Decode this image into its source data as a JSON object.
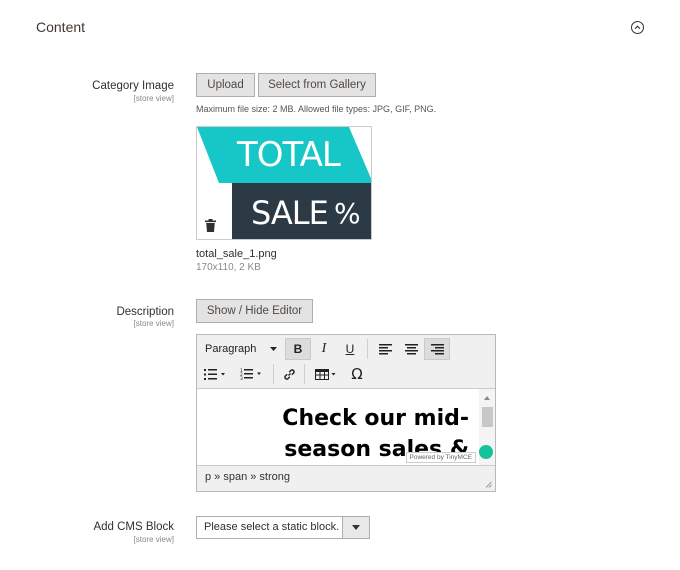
{
  "section": {
    "title": "Content"
  },
  "category_image": {
    "label": "Category Image",
    "scope": "[store view]",
    "upload_label": "Upload",
    "gallery_label": "Select from Gallery",
    "note": "Maximum file size: 2 MB. Allowed file types: JPG, GIF, PNG.",
    "preview": {
      "line1": "TOTAL",
      "line2": "SALE",
      "symbol": "%"
    },
    "file_name": "total_sale_1.png",
    "file_meta": "170x110, 2 KB"
  },
  "description": {
    "label": "Description",
    "scope": "[store view]",
    "toggle_label": "Show / Hide Editor",
    "editor": {
      "format_select": "Paragraph",
      "bold": "B",
      "italic": "I",
      "underline": "U",
      "content_text": "Check our mid-season sales &",
      "powered_by": "Powered by TinyMCE",
      "status_path": "p » span » strong"
    }
  },
  "cms_block": {
    "label": "Add CMS Block",
    "scope": "[store view]",
    "placeholder": "Please select a static block."
  }
}
